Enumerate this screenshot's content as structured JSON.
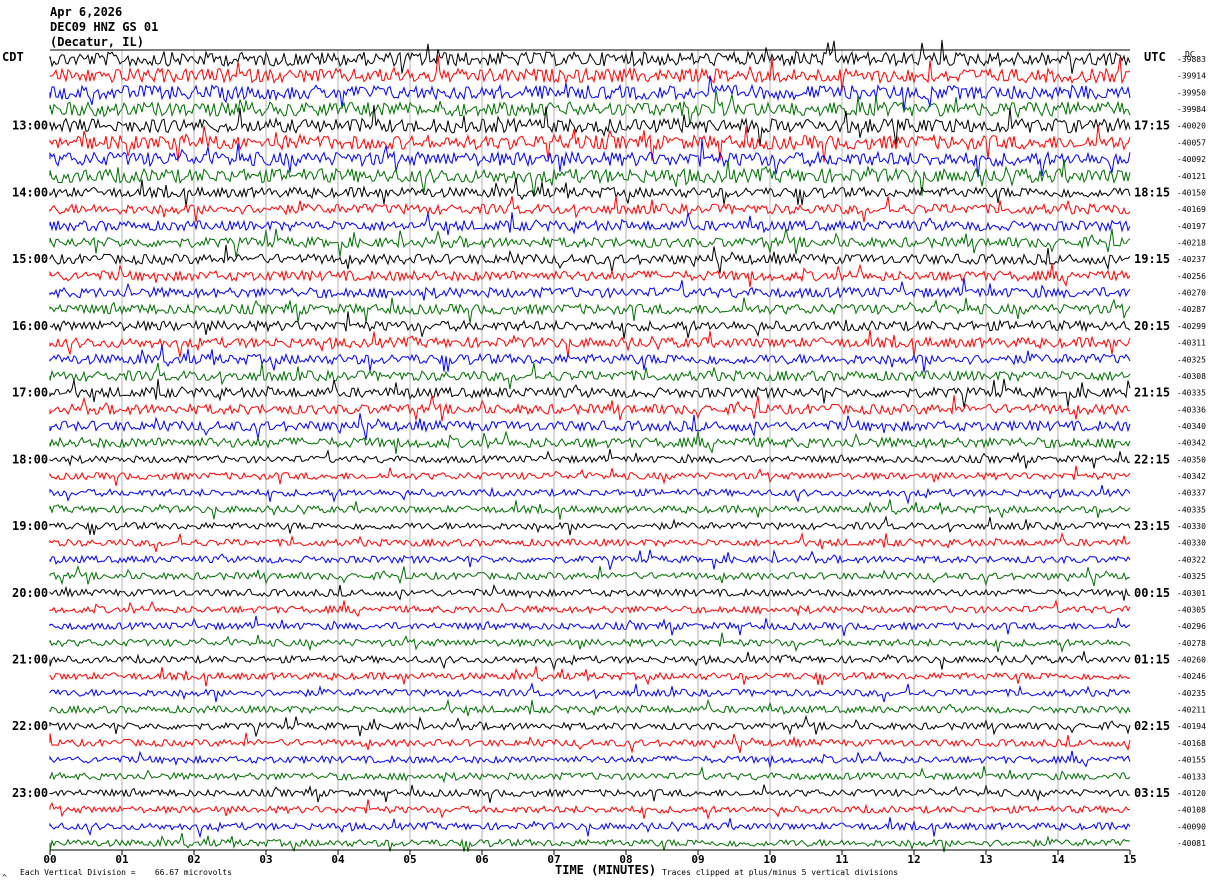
{
  "header": {
    "line1": "Apr 6,2026",
    "line2": "DEC09 HNZ GS 01",
    "line3": "(Decatur, IL)"
  },
  "left_tz": "CDT",
  "right_tz": "UTC",
  "dc_label": "DC",
  "footer": {
    "scale_note": "Each Vertical Division =    66.67 microvolts",
    "clip_note": "Traces clipped at plus/minus 5 vertical divisions",
    "corner_mark": "^"
  },
  "chart_data": {
    "type": "line",
    "title": "",
    "xlabel": "TIME (MINUTES)",
    "x_ticks": [
      "00",
      "01",
      "02",
      "03",
      "04",
      "05",
      "06",
      "07",
      "08",
      "09",
      "10",
      "11",
      "12",
      "13",
      "14",
      "15"
    ],
    "xlim": [
      0,
      15
    ],
    "left_hour_labels": [
      "13:00",
      "14:00",
      "15:00",
      "16:00",
      "17:00",
      "18:00",
      "19:00",
      "20:00",
      "21:00",
      "22:00",
      "23:00"
    ],
    "right_hour_labels": [
      "17:15",
      "18:15",
      "19:15",
      "20:15",
      "21:15",
      "22:15",
      "23:15",
      "00:15",
      "01:15",
      "02:15",
      "03:15"
    ],
    "trace_colors": [
      "#000000",
      "#ff0000",
      "#0000ff",
      "#007000"
    ],
    "traces_per_hour": 4,
    "trace_count": 48,
    "dc_offsets": [
      "-39883",
      "-39914",
      "-39950",
      "-39984",
      "-40020",
      "-40057",
      "-40092",
      "-40121",
      "-40150",
      "-40169",
      "-40197",
      "-40218",
      "-40237",
      "-40256",
      "-40270",
      "-40287",
      "-40299",
      "-40311",
      "-40325",
      "-40308",
      "-40335",
      "-40336",
      "-40340",
      "-40342",
      "-40350",
      "-40342",
      "-40337",
      "-40335",
      "-40330",
      "-40330",
      "-40322",
      "-40325",
      "-40301",
      "-40305",
      "-40296",
      "-40278",
      "-40260",
      "-40246",
      "-40235",
      "-40211",
      "-40194",
      "-40168",
      "-40155",
      "-40133",
      "-40120",
      "-40108",
      "-40090",
      "-40081"
    ]
  }
}
